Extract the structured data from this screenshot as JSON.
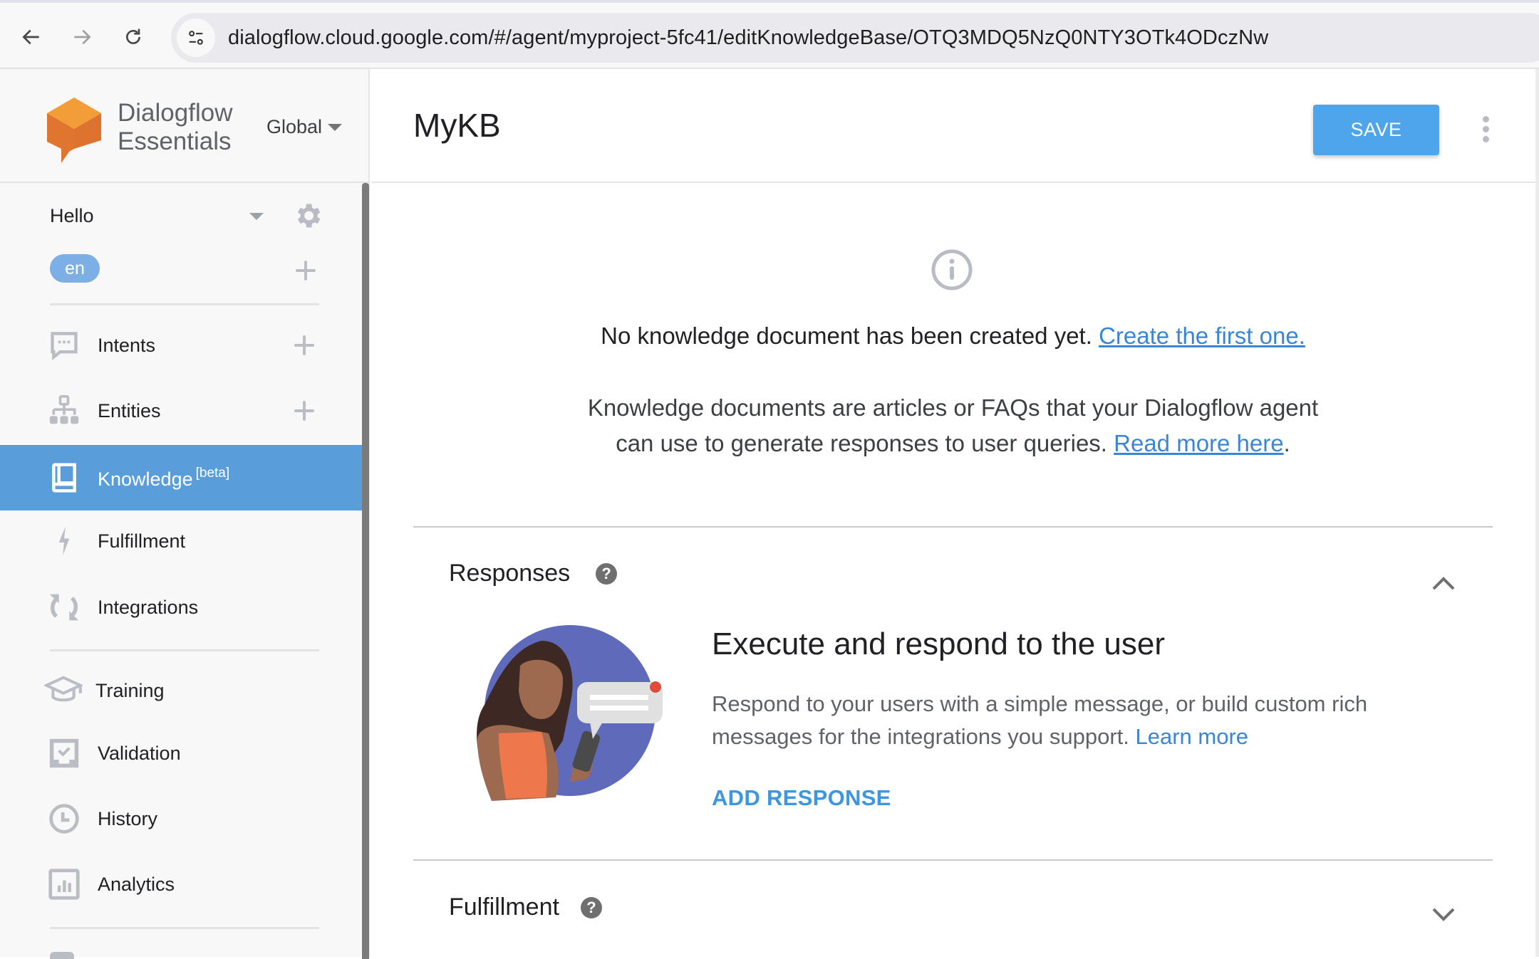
{
  "browser": {
    "url": "dialogflow.cloud.google.com/#/agent/myproject-5fc41/editKnowledgeBase/OTQ3MDQ5NzQ0NTY3OTk4ODczNw",
    "back_icon": "arrow-left",
    "forward_icon": "arrow-right",
    "reload_icon": "reload",
    "site_info_icon": "tune"
  },
  "sidebar": {
    "brand_line1": "Dialogflow",
    "brand_line2": "Essentials",
    "region": "Global",
    "agent_name": "Hello",
    "language": "en",
    "items": [
      {
        "label": "Intents",
        "icon": "chat-icon",
        "has_add": true,
        "active": false
      },
      {
        "label": "Entities",
        "icon": "hierarchy-icon",
        "has_add": true,
        "active": false
      },
      {
        "label": "Knowledge",
        "badge": "[beta]",
        "icon": "book-icon",
        "has_add": false,
        "active": true
      },
      {
        "label": "Fulfillment",
        "icon": "bolt-icon",
        "has_add": false,
        "active": false
      },
      {
        "label": "Integrations",
        "icon": "sync-icon",
        "has_add": false,
        "active": false
      },
      {
        "label": "Training",
        "icon": "graduation-cap-icon",
        "has_add": false,
        "active": false
      },
      {
        "label": "Validation",
        "icon": "validation-icon",
        "has_add": false,
        "active": false
      },
      {
        "label": "History",
        "icon": "clock-icon",
        "has_add": false,
        "active": false
      },
      {
        "label": "Analytics",
        "icon": "bar-chart-icon",
        "has_add": false,
        "active": false
      }
    ]
  },
  "header": {
    "title": "MyKB",
    "save_label": "SAVE"
  },
  "empty_state": {
    "message": "No knowledge document has been created yet.",
    "create_link": "Create the first one.",
    "desc_line1": "Knowledge documents are articles or FAQs that your Dialogflow agent",
    "desc_line2": "can use to generate responses to user queries.",
    "read_more_link": "Read more here",
    "desc_end": "."
  },
  "responses": {
    "title": "Responses",
    "heading": "Execute and respond to the user",
    "description": "Respond to your users with a simple message, or build custom rich messages for the integrations you support.",
    "learn_more": "Learn more",
    "add_button": "ADD RESPONSE",
    "expanded": true
  },
  "fulfillment": {
    "title": "Fulfillment",
    "expanded": false
  },
  "colors": {
    "accent": "#4ea5ea",
    "active_nav": "#599ddb",
    "link": "#3a86d6",
    "lang_chip": "#7bafe6",
    "logo_orange": "#e07530"
  }
}
